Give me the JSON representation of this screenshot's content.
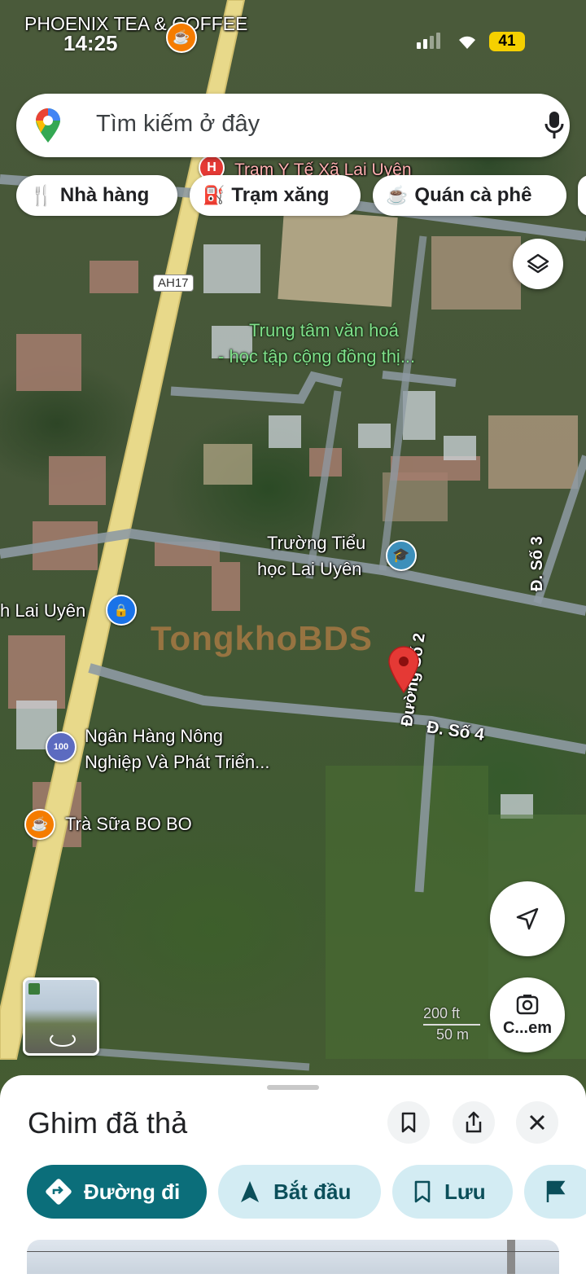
{
  "status_bar": {
    "time": "14:25",
    "battery": "41",
    "overlay_place": "PHOENIX TEA & COFFEE"
  },
  "search": {
    "placeholder": "Tìm kiếm ở đây"
  },
  "chips": [
    {
      "label": "Nhà hàng"
    },
    {
      "label": "Trạm xăng"
    },
    {
      "label": "Quán cà phê"
    }
  ],
  "map": {
    "labels": {
      "clinic": "Trạm Y Tế Xã Lai Uyên",
      "highway": "AH17",
      "culture_center_1": "Trung tâm văn hoá",
      "culture_center_2": "- học tập cộng đồng thị...",
      "school_1": "Trường Tiểu",
      "school_2": "học Lai Uyên",
      "lai_uyen": "h Lai Uyên",
      "road3": "Đ. Số 3",
      "road2": "Đường Số 2",
      "road4": "Đ. Số 4",
      "bank_1": "Ngân Hàng Nông",
      "bank_2": "Nghiệp Và Phát Triển...",
      "milktea": "Trà Sữa BO BO",
      "watermark": "TongkhoBDS",
      "scale_ft": "200 ft",
      "scale_m": "50 m",
      "camera_label": "C...em"
    }
  },
  "sheet": {
    "title": "Ghim đã thả",
    "actions": [
      {
        "label": "Đường đi"
      },
      {
        "label": "Bắt đầu"
      },
      {
        "label": "Lưu"
      }
    ]
  },
  "colors": {
    "primary": "#0b6e7a",
    "pill_bg": "#d3ecf3",
    "pin": "#e53935",
    "road_yellow": "#e8d98a"
  }
}
